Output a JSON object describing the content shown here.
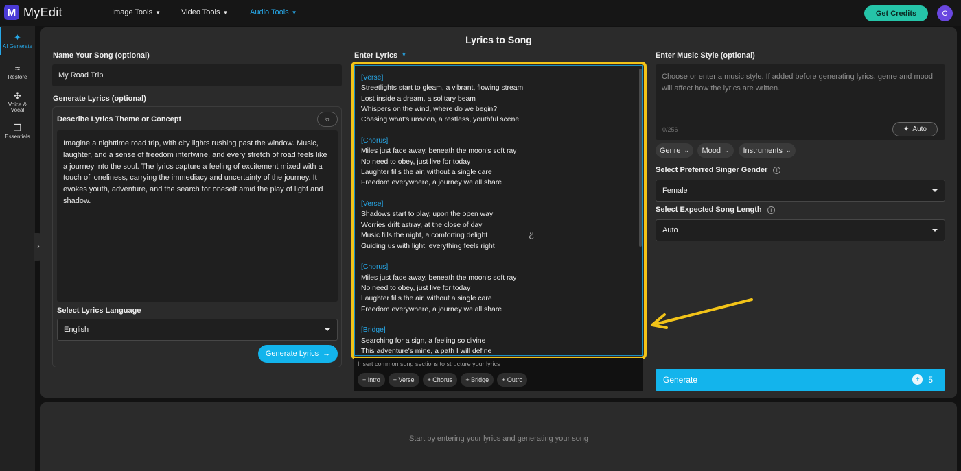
{
  "app": {
    "logo_letter": "M",
    "name": "MyEdit"
  },
  "nav": {
    "items": [
      {
        "label": "Image Tools",
        "icon": "chevron-down-icon"
      },
      {
        "label": "Video Tools",
        "icon": "chevron-down-icon"
      },
      {
        "label": "Audio Tools",
        "icon": "chevron-down-icon",
        "active": true
      }
    ],
    "credits_button": "Get Credits",
    "avatar_initial": "C"
  },
  "rail": {
    "items": [
      {
        "label": "AI Generate",
        "icon": "magic-wand-icon",
        "active": true
      },
      {
        "label": "Restore",
        "icon": "waveform-icon"
      },
      {
        "label": "Voice & Vocal",
        "icon": "voice-wand-icon"
      },
      {
        "label": "Essentials",
        "icon": "squares-icon"
      }
    ],
    "collapse_icon": "chevron-right-icon"
  },
  "page": {
    "title": "Lyrics to Song",
    "empty_message": "Start by entering your lyrics and generating your song"
  },
  "left": {
    "song_name_label": "Name Your Song (optional)",
    "song_name_value": "My Road Trip",
    "generate_lyrics_label": "Generate Lyrics (optional)",
    "theme_label": "Describe Lyrics Theme or Concept",
    "theme_value": "Imagine a nighttime road trip, with city lights rushing past the window. Music, laughter, and a sense of freedom intertwine, and every stretch of road feels like a journey into the soul. The lyrics capture a feeling of excitement mixed with a touch of loneliness, carrying the immediacy and uncertainty of the journey. It evokes youth, adventure, and the search for oneself amid the play of light and shadow.",
    "language_label": "Select Lyrics Language",
    "language_value": "English",
    "generate_lyrics_button": "Generate Lyrics",
    "generate_lyrics_arrow": "→"
  },
  "lyrics": {
    "label": "Enter Lyrics",
    "required_mark": "*",
    "lines": [
      {
        "text": "[Verse]",
        "section": true
      },
      {
        "text": "Streetlights start to gleam, a vibrant, flowing stream"
      },
      {
        "text": "Lost inside a dream, a solitary beam"
      },
      {
        "text": "Whispers on the wind, where do we begin?"
      },
      {
        "text": "Chasing what's unseen, a restless, youthful scene"
      },
      {
        "text": ""
      },
      {
        "text": "[Chorus]",
        "section": true
      },
      {
        "text": "Miles just fade away, beneath the moon's soft ray"
      },
      {
        "text": "No need to obey, just live for today"
      },
      {
        "text": "Laughter fills the air, without a single care"
      },
      {
        "text": "Freedom everywhere, a journey we all share"
      },
      {
        "text": ""
      },
      {
        "text": "[Verse]",
        "section": true
      },
      {
        "text": "Shadows start to play, upon the open way"
      },
      {
        "text": "Worries drift astray, at the close of day"
      },
      {
        "text": "Music fills the night, a comforting delight"
      },
      {
        "text": "Guiding us with light, everything feels right"
      },
      {
        "text": ""
      },
      {
        "text": "[Chorus]",
        "section": true
      },
      {
        "text": "Miles just fade away, beneath the moon's soft ray"
      },
      {
        "text": "No need to obey, just live for today"
      },
      {
        "text": "Laughter fills the air, without a single care"
      },
      {
        "text": "Freedom everywhere, a journey we all share"
      },
      {
        "text": ""
      },
      {
        "text": "[Bridge]",
        "section": true
      },
      {
        "text": "Searching for a sign, a feeling so divine"
      },
      {
        "text": "This adventure's mine, a path I will define"
      }
    ],
    "sections_hint": "Insert common song sections to structure your lyrics",
    "section_chips": [
      "+ Intro",
      "+ Verse",
      "+ Chorus",
      "+ Bridge",
      "+ Outro"
    ]
  },
  "right": {
    "style_label": "Enter Music Style (optional)",
    "style_placeholder": "Choose or enter a music style. If added before generating lyrics, genre and mood will affect how the lyrics are written.",
    "style_count": "0/256",
    "auto_button": "Auto",
    "filters": [
      "Genre",
      "Mood",
      "Instruments"
    ],
    "gender_label": "Select Preferred Singer Gender",
    "gender_value": "Female",
    "length_label": "Select Expected Song Length",
    "length_value": "Auto",
    "generate_button": "Generate",
    "generate_credits": "5"
  },
  "colors": {
    "accent": "#13b4ec",
    "highlight_frame": "#f2c318",
    "credits_button": "#25c4a8",
    "panel": "#2b2b2b"
  }
}
